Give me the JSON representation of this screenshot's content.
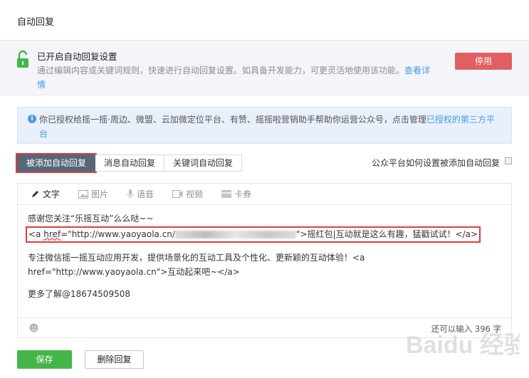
{
  "page": {
    "title": "自动回复"
  },
  "status": {
    "title": "已开启自动回复设置",
    "description": "通过编辑内容或关键词规则，快速进行自动回复设置。如具备开发能力，可更灵活地使用该功能。",
    "link": "查看详情",
    "disable_button": "停用",
    "icon": "unlocked-padlock-icon"
  },
  "notice": {
    "text": "你已授权给摇一摇·周边、微盟、云加微定位平台、有赞、摇摇啦营销助手帮助你运营公众号，点击管理",
    "link": "已授权的第三方平台"
  },
  "tabs": [
    {
      "label": "被添加自动回复",
      "active": true
    },
    {
      "label": "消息自动回复",
      "active": false
    },
    {
      "label": "关键词自动回复",
      "active": false
    }
  ],
  "help": {
    "label": "公众平台如何设置被添加自动回复"
  },
  "editor": {
    "toolbar": [
      {
        "label": "文字",
        "icon": "pencil-icon"
      },
      {
        "label": "图片",
        "icon": "image-icon"
      },
      {
        "label": "语音",
        "icon": "microphone-icon"
      },
      {
        "label": "视频",
        "icon": "video-icon"
      },
      {
        "label": "卡券",
        "icon": "card-icon"
      }
    ],
    "lines": {
      "l1": "感谢您关注“乐摇互动”么么哒~~",
      "l2_pre": "<a ",
      "l2_href": "href",
      "l2_url": "=\"http://www.yaoyaola.cn/",
      "l2_post": "\">摇红包|互动就是这么有趣，猛戳试试！</a>",
      "l3": "专注微信摇一摇互动应用开发，提供场景化的互动工具及个性化、更新颖的互动体验！<a href=\"http://www.yaoyaola.cn\">互动起来吧~</a>",
      "l4": "更多了解@18674509508"
    },
    "remaining": "还可以输入 396 字"
  },
  "actions": {
    "save": "保存",
    "delete": "删除回复"
  },
  "watermark": {
    "text": "Baidu 经验"
  },
  "colors": {
    "accent_green": "#44b549",
    "danger_red": "#e15f63",
    "link_blue": "#459ae9",
    "highlight": "#e03c3c"
  }
}
